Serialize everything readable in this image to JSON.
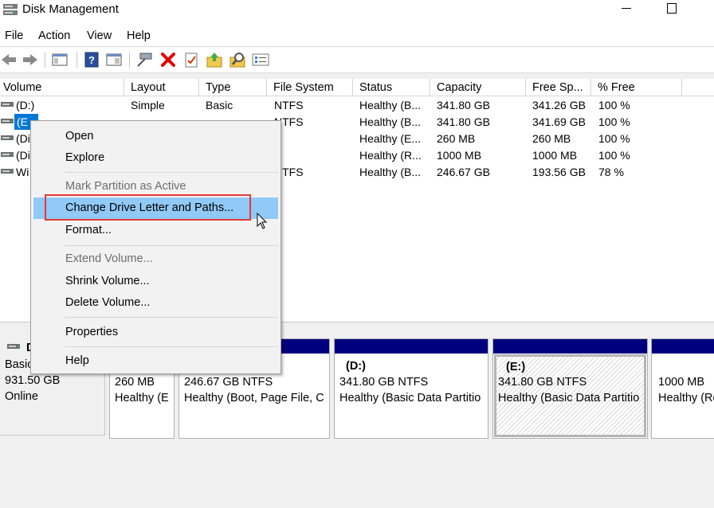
{
  "window": {
    "title": "Disk Management"
  },
  "menu": [
    "File",
    "Action",
    "View",
    "Help"
  ],
  "toolbar": {
    "icons": [
      "back-icon",
      "forward-icon",
      "console-tree-icon",
      "help-icon",
      "show-hide-icon",
      "connect-icon",
      "delete-icon",
      "check-icon",
      "rescan-icon",
      "search-icon",
      "properties-icon"
    ],
    "delete_color": "#e00000"
  },
  "columns": [
    "Volume",
    "Layout",
    "Type",
    "File System",
    "Status",
    "Capacity",
    "Free Sp...",
    "% Free"
  ],
  "volumes": [
    {
      "name": " (D:)",
      "layout": "Simple",
      "type": "Basic",
      "fs": "NTFS",
      "status": "Healthy (B...",
      "capacity": "341.80 GB",
      "free": "341.26 GB",
      "pct": "100 %"
    },
    {
      "name": "(E",
      "layout": "",
      "type": "",
      "fs": "NTFS",
      "status": "Healthy (B...",
      "capacity": "341.80 GB",
      "free": "341.69 GB",
      "pct": "100 %"
    },
    {
      "name": "(Di",
      "layout": "",
      "type": "",
      "fs": "",
      "status": "Healthy (E...",
      "capacity": "260 MB",
      "free": "260 MB",
      "pct": "100 %"
    },
    {
      "name": "(Di",
      "layout": "",
      "type": "",
      "fs": "",
      "status": "Healthy (R...",
      "capacity": "1000 MB",
      "free": "1000 MB",
      "pct": "100 %"
    },
    {
      "name": "Wi",
      "layout": "",
      "type": "",
      "fs": "NTFS",
      "status": "Healthy (B...",
      "capacity": "246.67 GB",
      "free": "193.56 GB",
      "pct": "78 %"
    }
  ],
  "context_menu": {
    "open": "Open",
    "explore": "Explore",
    "mark_active": "Mark Partition as Active",
    "change_letter": "Change Drive Letter and Paths...",
    "format": "Format...",
    "extend": "Extend Volume...",
    "shrink": "Shrink Volume...",
    "delete": "Delete Volume...",
    "properties": "Properties",
    "help": "Help"
  },
  "disk": {
    "label": "D",
    "type": "Basic",
    "size": "931.50 GB",
    "state": "Online"
  },
  "partitions": [
    {
      "title": "",
      "size": "260 MB",
      "status": "Healthy (E"
    },
    {
      "title": "",
      "size": "246.67 GB NTFS",
      "status": "Healthy (Boot, Page File, C"
    },
    {
      "title": "(D:)",
      "size": "341.80 GB NTFS",
      "status": "Healthy (Basic Data Partitio"
    },
    {
      "title": "(E:)",
      "size": "341.80 GB NTFS",
      "status": "Healthy (Basic Data Partitio"
    },
    {
      "title": "",
      "size": "1000 MB",
      "status": "Healthy (Re"
    }
  ],
  "colors": {
    "selection": "#0078d7",
    "menu_highlight": "#91c9f7",
    "partition_bar": "#00007f",
    "annotation": "#e53935"
  }
}
